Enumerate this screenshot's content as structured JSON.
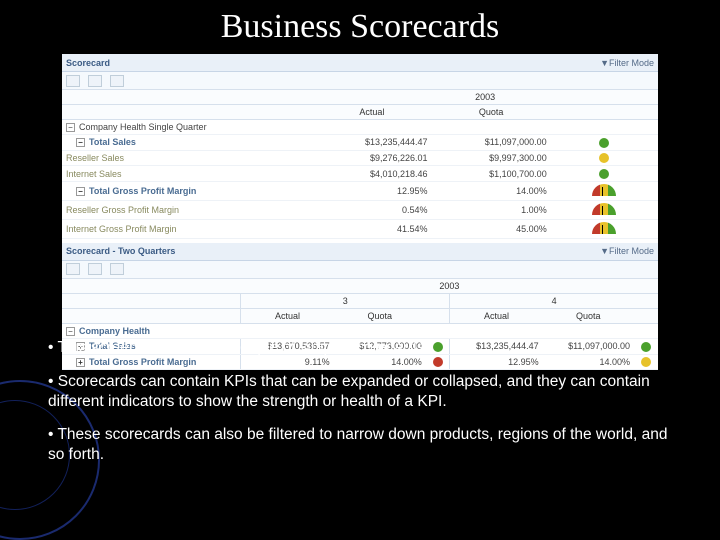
{
  "title": "Business Scorecards",
  "scorecard1": {
    "header": "Scorecard",
    "filter": "▼Filter Mode",
    "year": "2003",
    "cols": {
      "actual": "Actual",
      "quota": "Quota"
    },
    "group_label": "Company Health    Single Quarter",
    "rows": {
      "total_sales": {
        "label": "Total Sales",
        "actual": "$13,235,444.47",
        "quota": "$11,097,000.00"
      },
      "reseller_sales": {
        "label": "Reseller Sales",
        "actual": "$9,276,226.01",
        "quota": "$9,997,300.00"
      },
      "internet_sales": {
        "label": "Internet Sales",
        "actual": "$4,010,218.46",
        "quota": "$1,100,700.00"
      },
      "tgpm": {
        "label": "Total Gross Profit Margin",
        "actual": "12.95%",
        "quota": "14.00%"
      },
      "reseller_gpm": {
        "label": "Reseller Gross Profit Margin",
        "actual": "0.54%",
        "quota": "1.00%"
      },
      "internet_gpm": {
        "label": "Internet Gross Profit Margin",
        "actual": "41.54%",
        "quota": "45.00%"
      }
    }
  },
  "scorecard2": {
    "header": "Scorecard - Two Quarters",
    "filter": "▼Filter Mode",
    "year": "2003",
    "q3": "3",
    "q4": "4",
    "cols": {
      "actual": "Actual",
      "quota": "Quota"
    },
    "group_label": "Company Health",
    "rows": {
      "total_sales": {
        "label": "Total Sales",
        "a3": "$13,670,536.57",
        "q3": "$12,773,000.00",
        "a4": "$13,235,444.47",
        "q4": "$11,097,000.00"
      },
      "tgpm": {
        "label": "Total Gross Profit Margin",
        "a3": "9.11%",
        "q3": "14.00%",
        "a4": "12.95%",
        "q4": "14.00%"
      }
    }
  },
  "bullets": {
    "b1": "• This screenshot shows a couple of simple scorecards.",
    "b2": "•  Scorecards can contain KPIs that can be expanded or collapsed, and they can contain different indicators to show the strength or health of a KPI.",
    "b3": "•  These scorecards can also be filtered to narrow down products, regions of the world, and so forth."
  }
}
